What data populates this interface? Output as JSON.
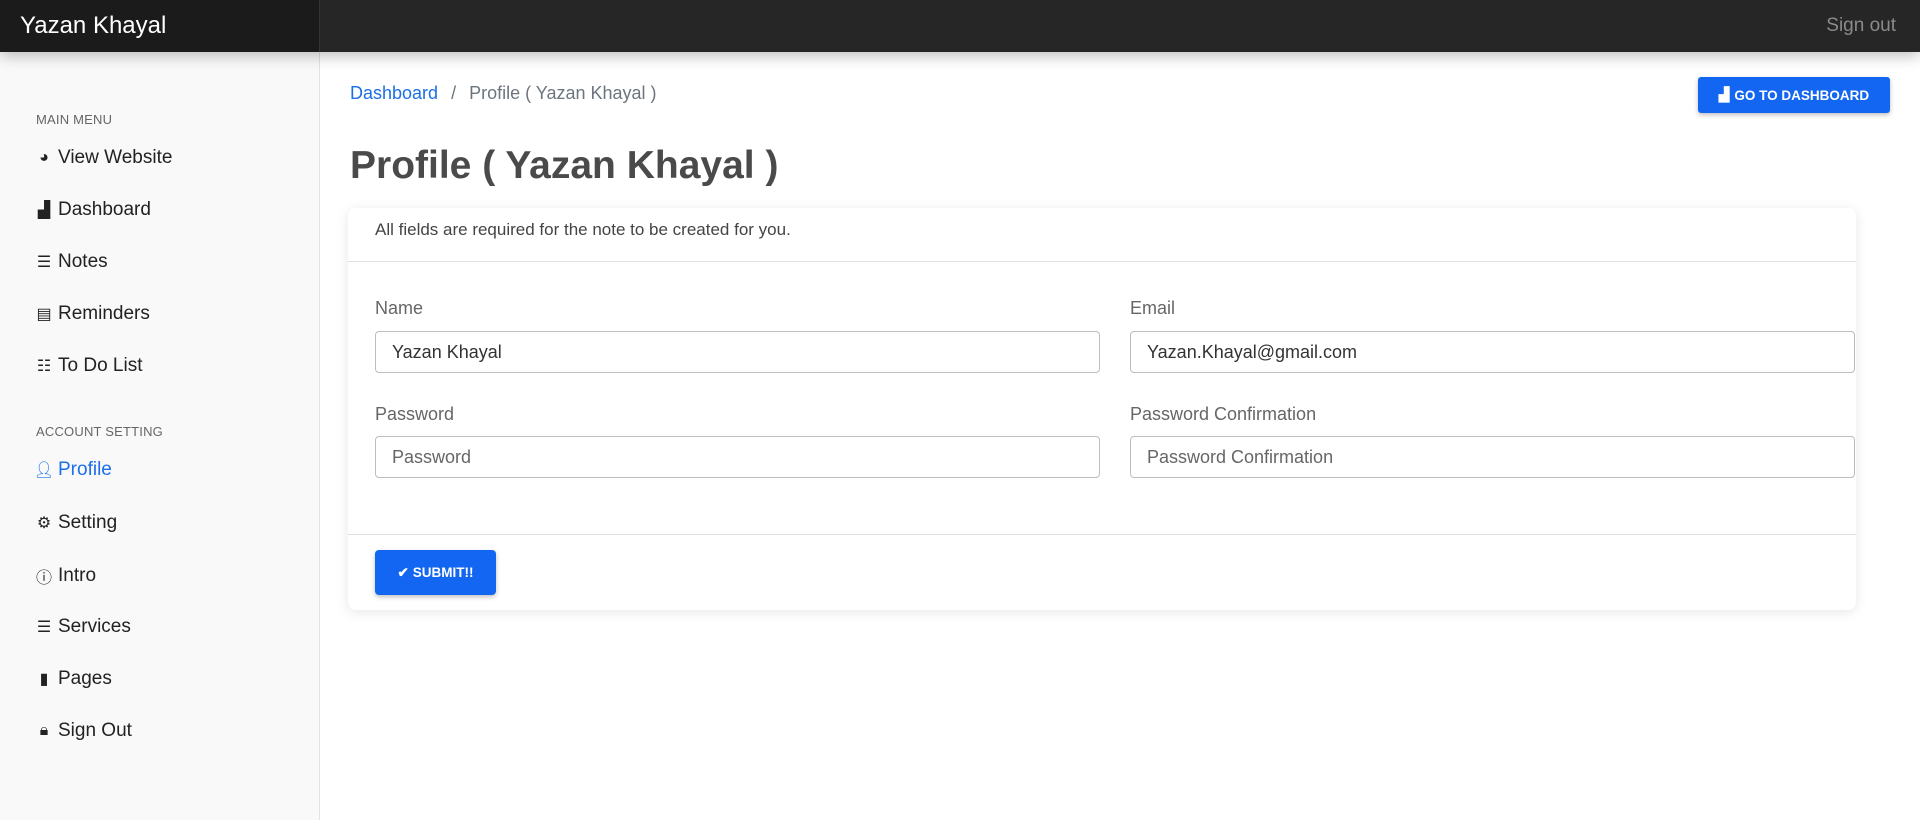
{
  "header": {
    "brand": "Yazan Khayal",
    "sign_out": "Sign out"
  },
  "sidebar": {
    "sections": [
      {
        "title": "MAIN MENU"
      },
      {
        "title": "ACCOUNT SETTING"
      }
    ],
    "items": [
      {
        "label": "View Website",
        "icon": "globe-icon"
      },
      {
        "label": "Dashboard",
        "icon": "dashboard-icon"
      },
      {
        "label": "Notes",
        "icon": "list-icon"
      },
      {
        "label": "Reminders",
        "icon": "list-alt-icon"
      },
      {
        "label": "To Do List",
        "icon": "list-ol-icon"
      },
      {
        "label": "Profile",
        "icon": "user-icon",
        "active": true
      },
      {
        "label": "Setting",
        "icon": "cogs-icon"
      },
      {
        "label": "Intro",
        "icon": "info-circle-icon"
      },
      {
        "label": "Services",
        "icon": "server-icon"
      },
      {
        "label": "Pages",
        "icon": "file-icon"
      },
      {
        "label": "Sign Out",
        "icon": "lock-icon"
      }
    ]
  },
  "breadcrumb": {
    "root": "Dashboard",
    "separator": "/",
    "current": "Profile ( Yazan Khayal )"
  },
  "toolbar": {
    "go_to_dashboard": "GO TO DASHBOARD"
  },
  "page_title": "Profile ( Yazan Khayal )",
  "form": {
    "note": "All fields are required for the note to be created for you.",
    "name": {
      "label": "Name",
      "value": "Yazan Khayal"
    },
    "email": {
      "label": "Email",
      "value": "Yazan.Khayal@gmail.com"
    },
    "password": {
      "label": "Password",
      "placeholder": "Password"
    },
    "password_confirmation": {
      "label": "Password Confirmation",
      "placeholder": "Password Confirmation"
    },
    "submit": "SUBMIT!!"
  },
  "colors": {
    "accent": "#1266f1",
    "topbar": "#262626",
    "sidebar": "#f9f9f9"
  }
}
